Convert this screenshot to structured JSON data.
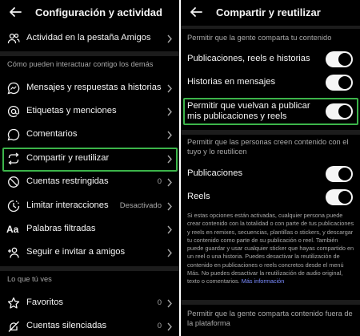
{
  "left": {
    "title": "Configuración y actividad",
    "rows_top": [
      {
        "icon": "people-icon",
        "label": "Actividad en la pestaña Amigos"
      }
    ],
    "section1": "Cómo pueden interactuar contigo los demás",
    "rows_mid": [
      {
        "icon": "message-bubble-icon",
        "label": "Mensajes y respuestas a historias",
        "value": ""
      },
      {
        "icon": "at-sign-icon",
        "label": "Etiquetas y menciones",
        "value": ""
      },
      {
        "icon": "comment-icon",
        "label": "Comentarios",
        "value": ""
      },
      {
        "icon": "share-reuse-icon",
        "label": "Compartir y reutilizar",
        "value": ""
      },
      {
        "icon": "restricted-icon",
        "label": "Cuentas restringidas",
        "value": "0"
      },
      {
        "icon": "limit-icon",
        "label": "Limitar interacciones",
        "value": "Desactivado"
      },
      {
        "icon": "filtered-words-icon",
        "label": "Palabras filtradas",
        "value": ""
      },
      {
        "icon": "follow-invite-icon",
        "label": "Seguir e invitar a amigos",
        "value": ""
      }
    ],
    "section2": "Lo que tú ves",
    "rows_bottom": [
      {
        "icon": "star-icon",
        "label": "Favoritos",
        "value": "0"
      },
      {
        "icon": "muted-icon",
        "label": "Cuentas silenciadas",
        "value": "0"
      }
    ]
  },
  "right": {
    "title": "Compartir y reutilizar",
    "section1": "Permitir que la gente comparta tu contenido",
    "toggles1": [
      {
        "label": "Publicaciones, reels e historias",
        "on": true
      },
      {
        "label": "Historias en mensajes",
        "on": true
      },
      {
        "label": "Permitir que vuelvan a publicar mis publicaciones y reels",
        "on": true
      }
    ],
    "section2": "Permitir que las personas creen contenido con el tuyo y lo reutilicen",
    "toggles2": [
      {
        "label": "Publicaciones",
        "on": true
      },
      {
        "label": "Reels",
        "on": true
      }
    ],
    "description": "Si estas opciones están activadas, cualquier persona puede crear contenido con la totalidad o con parte de tus publicaciones y reels en remixes, secuencias, plantillas o stickers, y descargar tu contenido como parte de su publicación o reel. También puede guardar y usar cualquier sticker que hayas compartido en un reel o una historia. Puedes desactivar la reutilización de contenido en publicaciones o reels concretos desde el menú Más. No puedes desactivar la reutilización de audio original, texto o comentarios.",
    "more_link": "Más información",
    "section3": "Permitir que la gente comparta contenido fuera de la plataforma"
  },
  "colors": {
    "background": "#000000",
    "text": "#f5f5f5",
    "muted": "#a8a8a8",
    "highlight": "#3cb44a",
    "link": "#7b8cff"
  }
}
